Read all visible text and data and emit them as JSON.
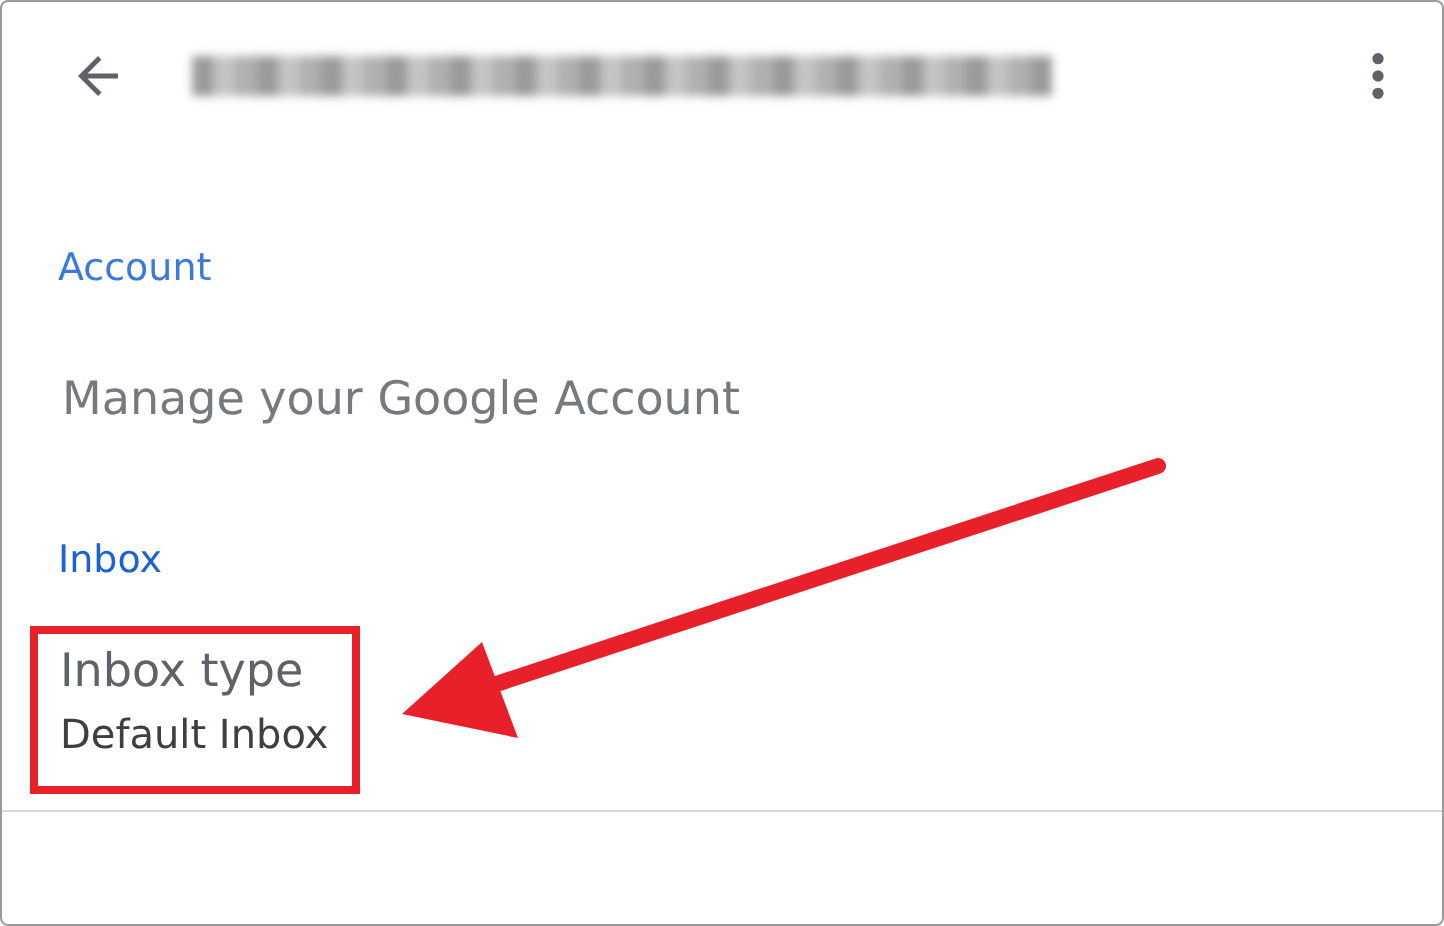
{
  "sections": [
    {
      "header": "Account",
      "items": [
        {
          "title": "Manage your Google Account",
          "highlighted": false
        }
      ]
    },
    {
      "header": "Inbox",
      "items": [
        {
          "title": "Inbox type",
          "subtitle": "Default Inbox",
          "highlighted": true
        }
      ]
    }
  ]
}
